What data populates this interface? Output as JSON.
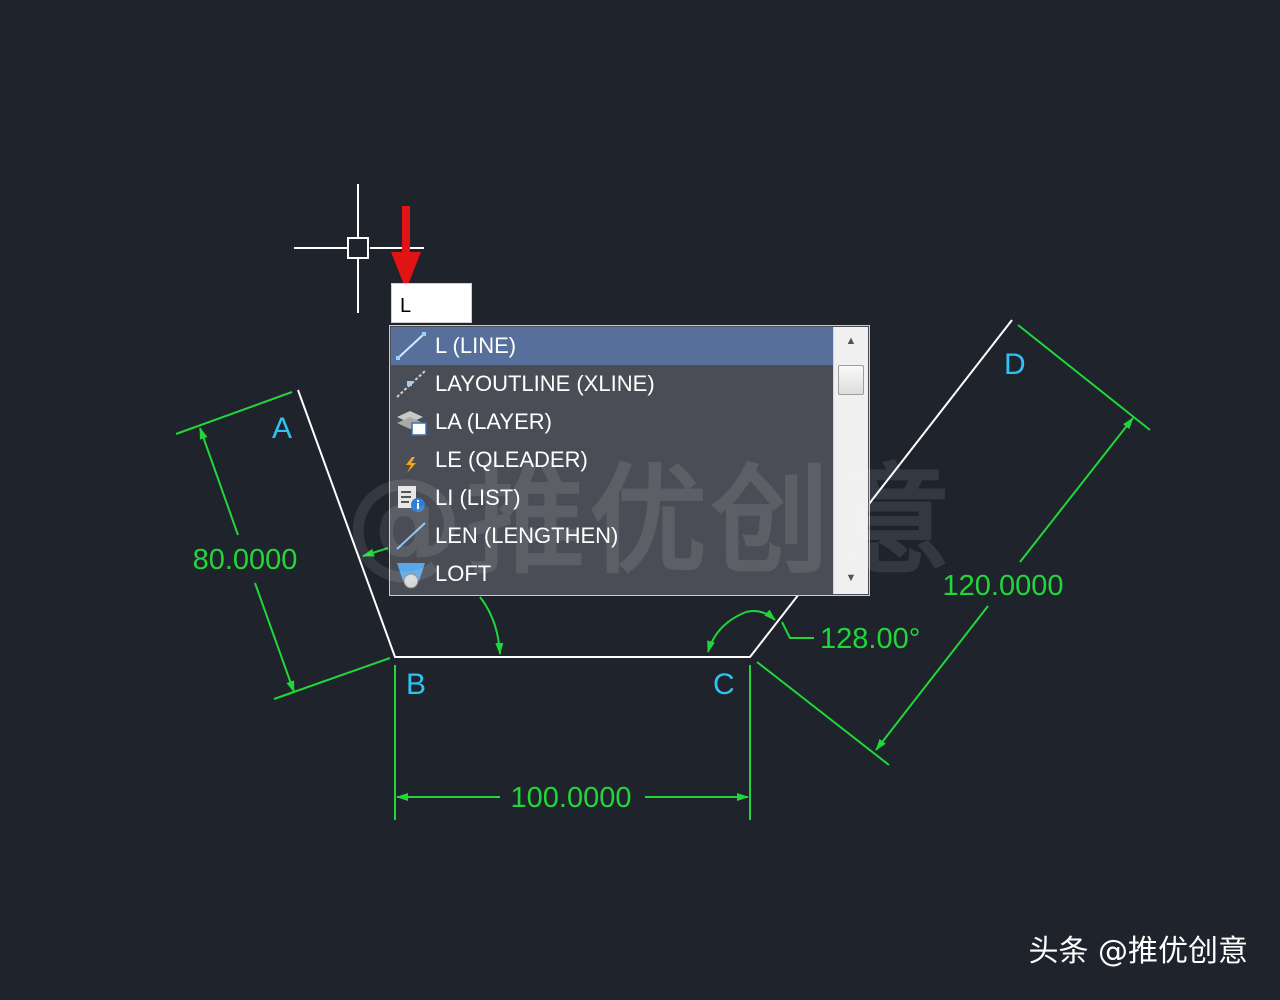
{
  "colors": {
    "background": "#1e232c",
    "geometry": "#ffffff",
    "dimension": "#22d63a",
    "point_label": "#2fc3f2",
    "pointer_arrow": "#e01414",
    "dropdown_bg": "#4a4d55",
    "dropdown_selected": "#566f9b"
  },
  "command_input": {
    "value": "L"
  },
  "autocomplete": {
    "items": [
      {
        "label": "L (LINE)",
        "icon": "line-icon",
        "selected": true
      },
      {
        "label": "LAYOUTLINE (XLINE)",
        "icon": "xline-icon",
        "selected": false
      },
      {
        "label": "LA (LAYER)",
        "icon": "layer-icon",
        "selected": false
      },
      {
        "label": "LE (QLEADER)",
        "icon": "qleader-icon",
        "selected": false
      },
      {
        "label": "LI (LIST)",
        "icon": "list-icon",
        "selected": false
      },
      {
        "label": "LEN (LENGTHEN)",
        "icon": "lengthen-icon",
        "selected": false
      },
      {
        "label": "LOFT",
        "icon": "loft-icon",
        "selected": false
      }
    ]
  },
  "drawing": {
    "points": {
      "a": "A",
      "b": "B",
      "c": "C",
      "d": "D"
    },
    "dimensions": {
      "ab_length": "80.0000",
      "bc_length": "100.0000",
      "cd_length": "120.0000",
      "angle_c": "128.00°"
    }
  },
  "watermark": {
    "text": "@推优创意"
  },
  "credit": {
    "text": "头条 @推优创意"
  }
}
